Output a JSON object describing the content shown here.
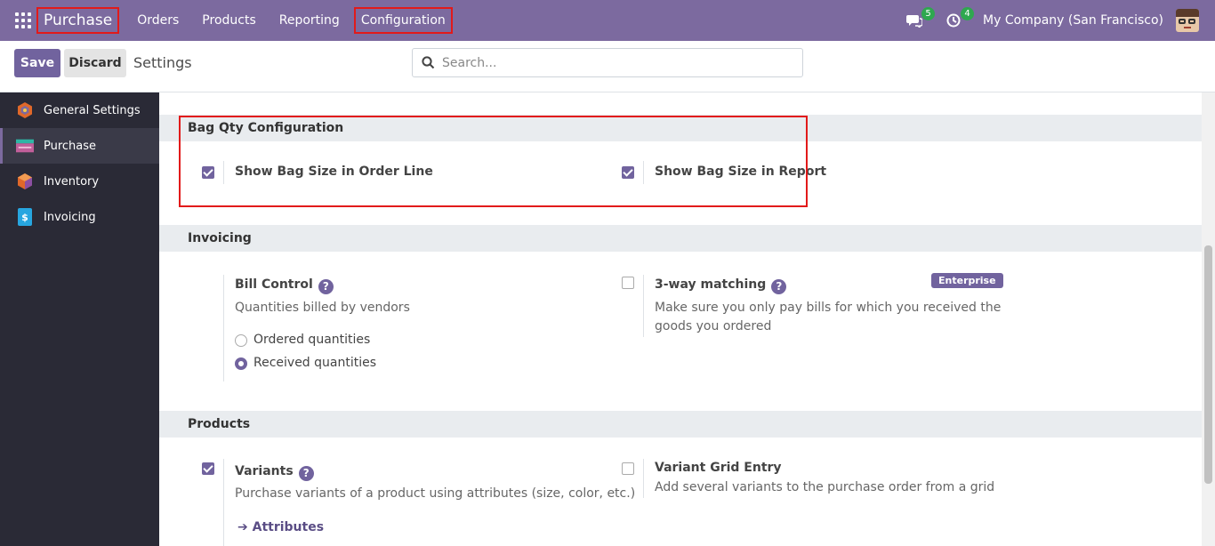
{
  "topbar": {
    "app_name": "Purchase",
    "menu": [
      "Orders",
      "Products",
      "Reporting",
      "Configuration"
    ],
    "messages_count": "5",
    "activities_count": "4",
    "company": "My Company (San Francisco)"
  },
  "control": {
    "save_label": "Save",
    "discard_label": "Discard",
    "title": "Settings",
    "search_placeholder": "Search..."
  },
  "sidebar": {
    "items": [
      {
        "label": "General Settings",
        "icon": "general-settings-icon"
      },
      {
        "label": "Purchase",
        "icon": "purchase-icon"
      },
      {
        "label": "Inventory",
        "icon": "inventory-icon"
      },
      {
        "label": "Invoicing",
        "icon": "invoicing-icon"
      }
    ]
  },
  "sections": {
    "bag": {
      "title": "Bag Qty Configuration",
      "order_line_label": "Show Bag Size in Order Line",
      "report_label": "Show Bag Size in Report"
    },
    "invoicing": {
      "title": "Invoicing",
      "bill_control_label": "Bill Control",
      "bill_control_desc": "Quantities billed by vendors",
      "radio_ordered": "Ordered quantities",
      "radio_received": "Received quantities",
      "three_way_label": "3-way matching",
      "three_way_desc": "Make sure you only pay bills for which you received the goods you ordered",
      "enterprise_badge": "Enterprise"
    },
    "products": {
      "title": "Products",
      "variants_label": "Variants",
      "variants_desc": "Purchase variants of a product using attributes (size, color, etc.)",
      "attributes_link": "Attributes",
      "grid_label": "Variant Grid Entry",
      "grid_desc": "Add several variants to the purchase order from a grid"
    }
  },
  "colors": {
    "brand": "#7c6a9f",
    "accent": "#71639e",
    "highlight": "#e21a1a"
  }
}
